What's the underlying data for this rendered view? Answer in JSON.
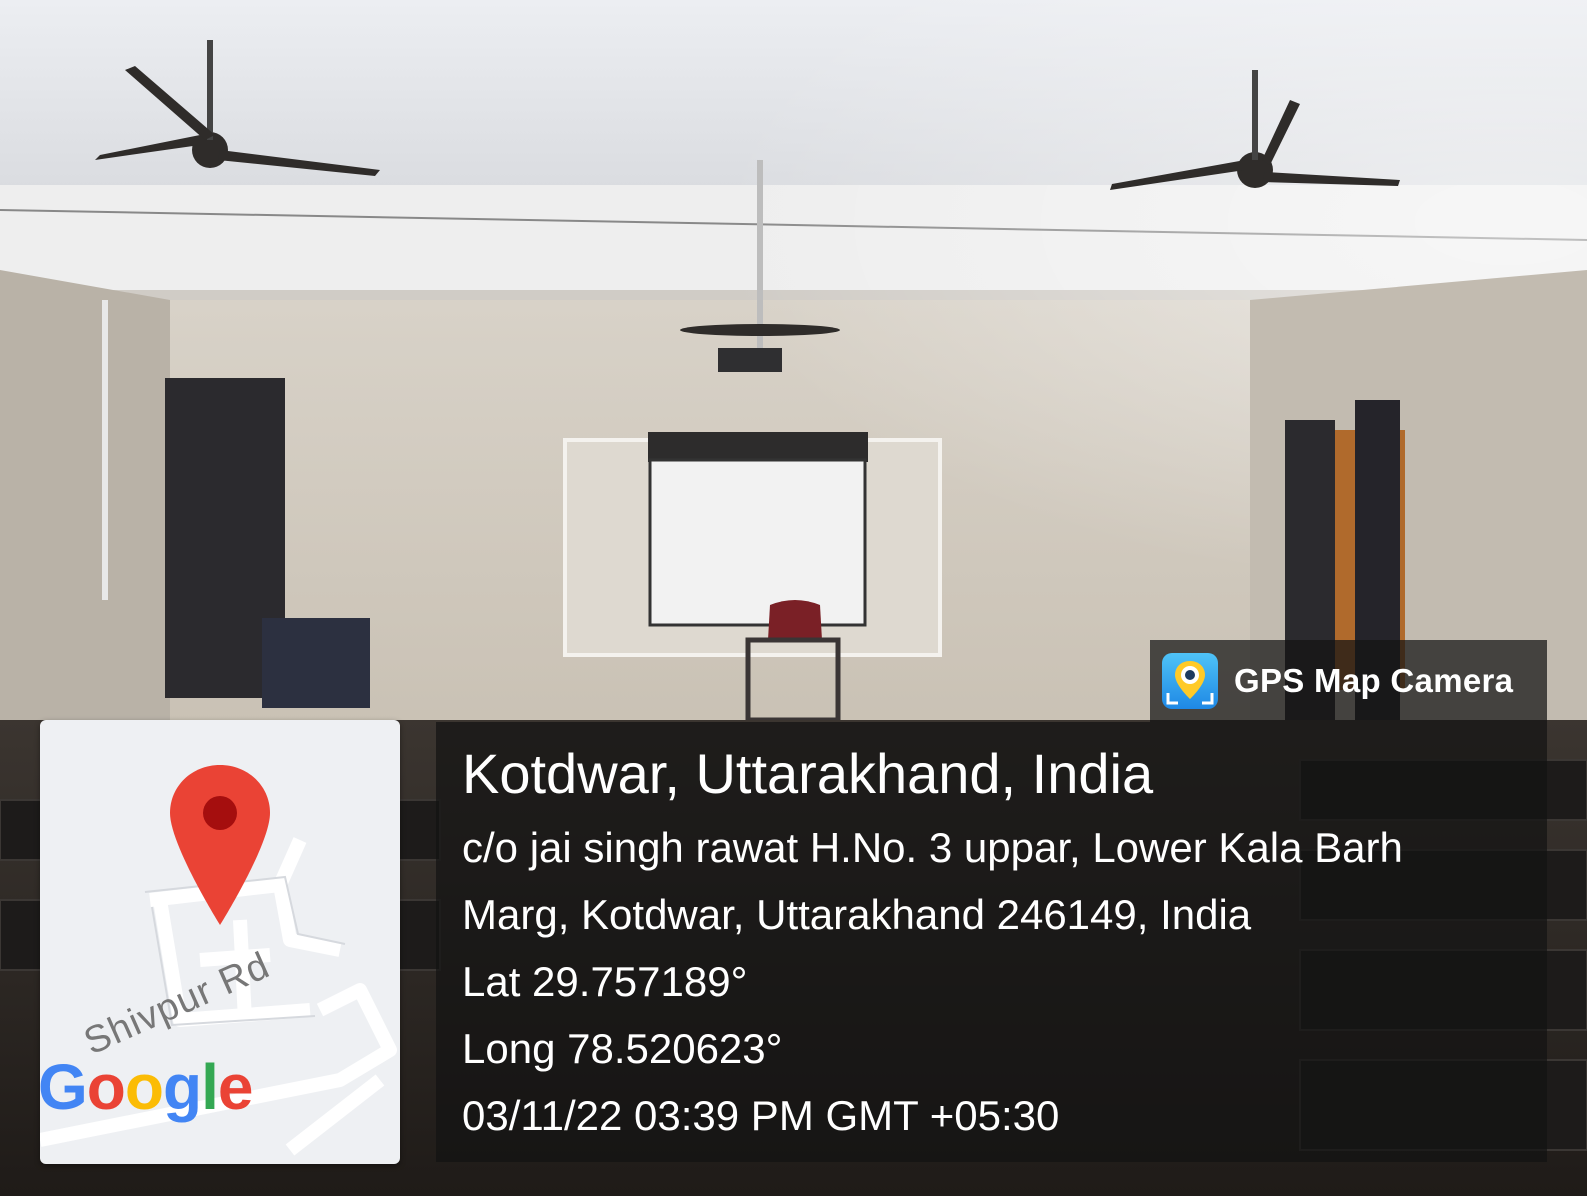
{
  "app_badge": {
    "name": "GPS Map Camera",
    "icon": "map-camera-icon"
  },
  "location": {
    "title": "Kotdwar, Uttarakhand, India",
    "address_line1": "c/o jai singh rawat H.No. 3 uppar, Lower Kala Barh",
    "address_line2": "Marg, Kotdwar, Uttarakhand 246149, India",
    "latitude": "Lat 29.757189°",
    "longitude": "Long 78.520623°",
    "datetime": "03/11/22 03:39 PM GMT +05:30"
  },
  "map": {
    "road_label": "Shivpur Rd",
    "logo_letters": [
      "G",
      "o",
      "o",
      "g",
      "l",
      "e"
    ],
    "logo_colors": [
      "#4285F4",
      "#EA4335",
      "#FBBC05",
      "#4285F4",
      "#34A853",
      "#EA4335"
    ],
    "pin_color": "#EA4335"
  }
}
